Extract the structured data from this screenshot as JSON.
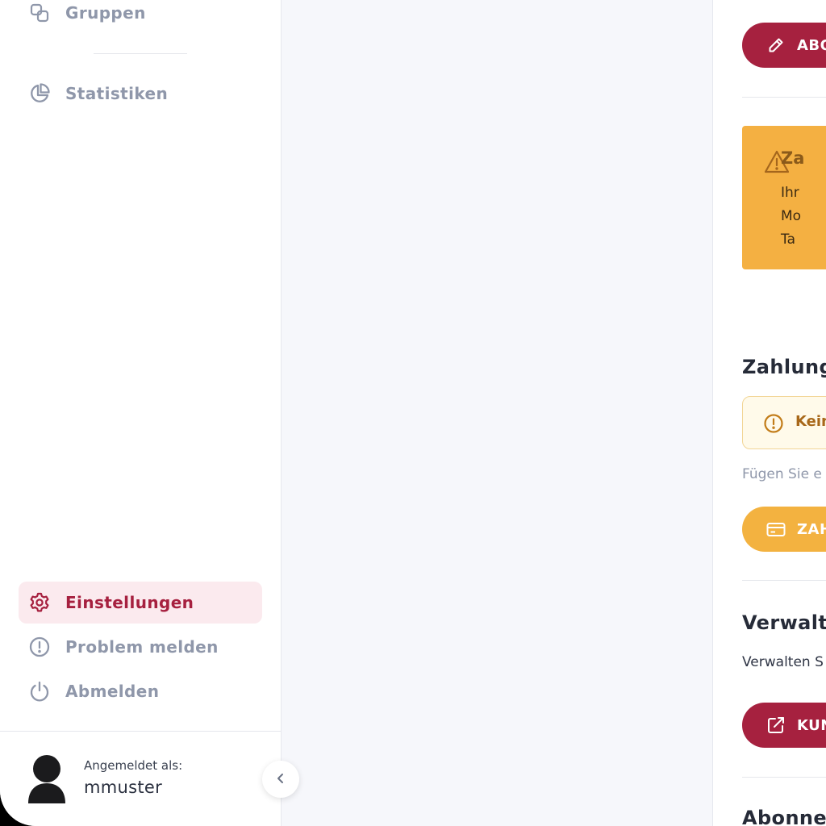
{
  "sidebar": {
    "nav_top": [
      {
        "label": "Gruppen",
        "icon": "groups-icon"
      },
      {
        "label": "Statistiken",
        "icon": "pie-chart-icon"
      }
    ],
    "nav_bottom": [
      {
        "label": "Einstellungen",
        "icon": "gear-icon",
        "active": true
      },
      {
        "label": "Problem melden",
        "icon": "exclamation-circle-icon"
      },
      {
        "label": "Abmelden",
        "icon": "power-icon"
      }
    ],
    "user": {
      "caption": "Angemeldet als:",
      "username": "mmuster"
    },
    "collapse_icon": "chevron-left-icon"
  },
  "panel": {
    "abo_button_label": "ABO",
    "warning": {
      "title": "Za",
      "lines": [
        "Ihr",
        "Mo",
        "Ta"
      ],
      "icon": "warning-triangle-icon"
    },
    "payment_section_title": "Zahlung",
    "payment_notice": "Kein",
    "payment_hint": "Fügen Sie e",
    "payment_button_label": "ZAH",
    "manage_section_title": "Verwaltu",
    "manage_text": "Verwalten S",
    "customer_button_label": "KUN",
    "subscription_section_title": "Abonnen"
  },
  "colors": {
    "accent": "#a6213f",
    "amber": "#f3b240",
    "muted": "#8f97aa",
    "active_bg": "#fbeaee"
  }
}
